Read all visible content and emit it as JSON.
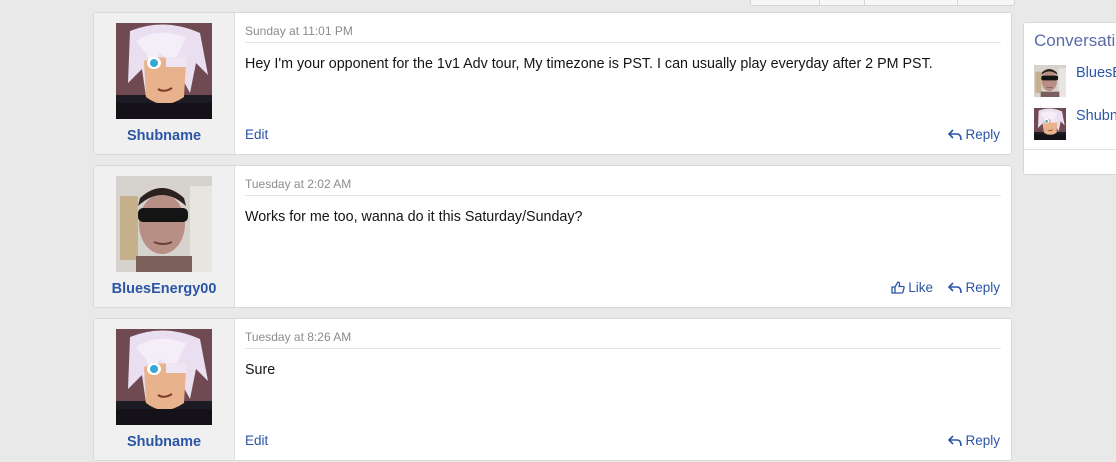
{
  "posts": [
    {
      "username": "Shubname",
      "avatar": "anime-avatar",
      "time": "Sunday at 11:01 PM",
      "message": "Hey I'm your opponent for the 1v1 Adv tour, My timezone is PST. I can usually play everyday after 2 PM PST.",
      "edit_label": "Edit",
      "reply_label": "Reply"
    },
    {
      "username": "BluesEnergy00",
      "avatar": "photo-avatar",
      "time": "Tuesday at 2:02 AM",
      "message": "Works for me too, wanna do it this Saturday/Sunday?",
      "like_label": "Like",
      "reply_label": "Reply"
    },
    {
      "username": "Shubname",
      "avatar": "anime-avatar",
      "time": "Tuesday at 8:26 AM",
      "message": "Sure",
      "edit_label": "Edit",
      "reply_label": "Reply"
    }
  ],
  "sidebar": {
    "title": "Conversati",
    "participants": [
      {
        "name": "BluesE",
        "avatar": "photo-avatar"
      },
      {
        "name": "Shubn",
        "avatar": "anime-avatar"
      }
    ]
  },
  "colors": {
    "link": "#2b55a6",
    "meta": "#8c8c8c",
    "background": "#e9e9e9"
  }
}
